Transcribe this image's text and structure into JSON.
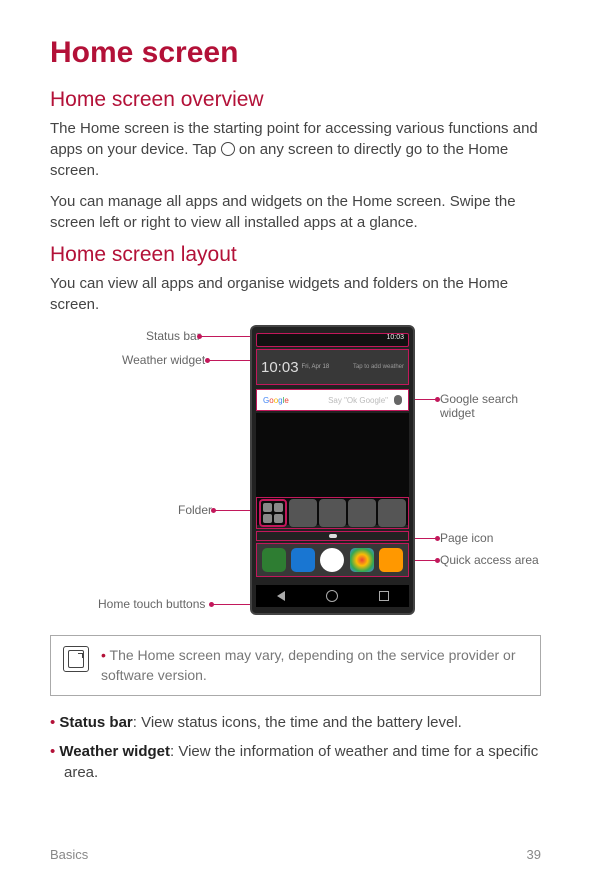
{
  "title": "Home screen",
  "section1": {
    "heading": "Home screen overview",
    "p1a": "The Home screen is the starting point for accessing various functions and apps on your device. Tap ",
    "p1b": " on any screen to directly go to the Home screen.",
    "p2": "You can manage all apps and widgets on the Home screen. Swipe the screen left or right to view all installed apps at a glance."
  },
  "section2": {
    "heading": "Home screen layout",
    "p1": "You can view all apps and organise widgets and folders on the Home screen."
  },
  "callouts": {
    "statusbar": "Status bar",
    "weather": "Weather widget",
    "folder": "Folder",
    "htb": "Home touch buttons",
    "google": "Google search widget",
    "pageicon": "Page icon",
    "quick": "Quick access area"
  },
  "phone": {
    "status_right": "10:03",
    "weather_time": "10:03",
    "weather_date": "Fri, Apr 18",
    "weather_tap": "Tap to add weather",
    "google_hint": "Say \"Ok Google\""
  },
  "note": "The Home screen may vary, depending on the service provider or software version.",
  "bullets": {
    "b1_label": "Status bar",
    "b1_text": ": View status icons, the time and the battery level.",
    "b2_label": "Weather widget",
    "b2_text": ": View the information of weather and time for a specific area."
  },
  "footer": {
    "left": "Basics",
    "right": "39"
  }
}
